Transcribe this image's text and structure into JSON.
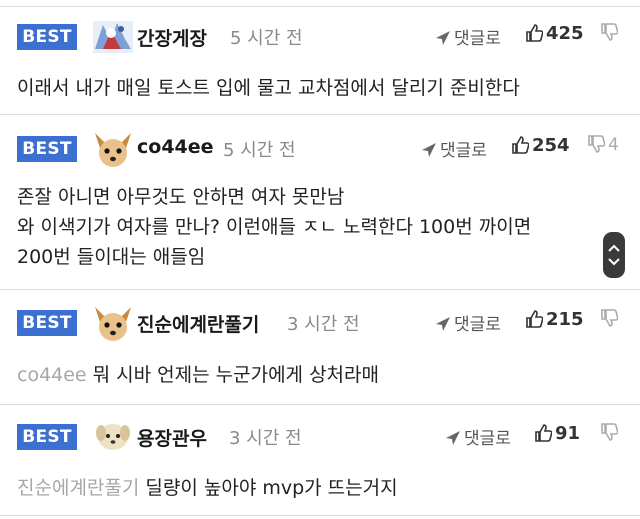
{
  "comments": [
    {
      "badge": "BEST",
      "avatar_icon": "ice-character-avatar-icon",
      "nickname": "간장게장",
      "time": "5 시간 전",
      "reply_label": "댓글로",
      "likes": "425",
      "dislikes": "",
      "text": [
        "이래서 내가 매일 토스트 입에 물고 교차점에서 달리기 준비한다"
      ]
    },
    {
      "badge": "BEST",
      "avatar_icon": "chihuahua-avatar-icon",
      "nickname": "co44ee",
      "time": "5 시간 전",
      "reply_label": "댓글로",
      "likes": "254",
      "dislikes": "4",
      "text": [
        "존잘 아니면 아무것도 안하면 여자 못만남",
        "와 이색기가 여자를 만나? 이런애들 ㅈㄴ 노력한다 100번 까이면",
        "200번 들이대는 애들임"
      ]
    },
    {
      "badge": "BEST",
      "avatar_icon": "chihuahua-avatar-icon",
      "nickname": "진순에계란풀기",
      "time": "3 시간 전",
      "reply_label": "댓글로",
      "likes": "215",
      "dislikes": "",
      "mention": "co44ee",
      "text": [
        "뭐 시바 언제는 누군가에게 상처라매"
      ]
    },
    {
      "badge": "BEST",
      "avatar_icon": "puppy-avatar-icon",
      "nickname": "용장관우",
      "time": "3 시간 전",
      "reply_label": "댓글로",
      "likes": "91",
      "dislikes": "",
      "mention": "진순에계란풀기",
      "text": [
        "딜량이 높아야 mvp가 뜨는거지"
      ]
    }
  ],
  "colors": {
    "best_badge": "#3b6fd1",
    "mention": "#a7a7a7",
    "time": "#8a8a8a"
  }
}
